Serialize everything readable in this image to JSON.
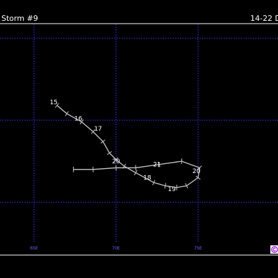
{
  "header": {
    "title": "Storm #9",
    "dates": "14-22 D"
  },
  "map": {
    "grid_color": "#3a3aff",
    "frame_color": "#ffffff",
    "track_color": "#c8c8c8",
    "longitude_ticks": [
      {
        "value": 65,
        "label": "65E"
      },
      {
        "value": 70,
        "label": "70E"
      },
      {
        "value": 75,
        "label": "75E"
      }
    ],
    "latitude_gridlines": 3,
    "track_points": [
      {
        "lon": 66.4,
        "lat": 15.9
      },
      {
        "lon": 67.0,
        "lat": 15.4
      },
      {
        "lon": 67.9,
        "lat": 14.9
      },
      {
        "lon": 68.6,
        "lat": 14.3
      },
      {
        "lon": 69.2,
        "lat": 13.7
      },
      {
        "lon": 69.6,
        "lat": 13.0
      },
      {
        "lon": 70.0,
        "lat": 12.6
      },
      {
        "lon": 70.5,
        "lat": 12.2
      },
      {
        "lon": 71.2,
        "lat": 11.8
      },
      {
        "lon": 72.3,
        "lat": 11.2
      },
      {
        "lon": 73.0,
        "lat": 11.0
      },
      {
        "lon": 73.7,
        "lat": 10.9
      },
      {
        "lon": 74.3,
        "lat": 11.0
      },
      {
        "lon": 75.0,
        "lat": 11.5
      },
      {
        "lon": 75.1,
        "lat": 12.1
      },
      {
        "lon": 74.0,
        "lat": 12.5
      },
      {
        "lon": 72.6,
        "lat": 12.3
      },
      {
        "lon": 71.2,
        "lat": 12.1
      },
      {
        "lon": 70.0,
        "lat": 12.1
      },
      {
        "lon": 68.6,
        "lat": 12.0
      },
      {
        "lon": 67.4,
        "lat": 12.0
      }
    ],
    "day_labels": [
      {
        "text": "15",
        "lon": 66.2,
        "lat": 16.1
      },
      {
        "text": "16",
        "lon": 67.7,
        "lat": 15.1
      },
      {
        "text": "17",
        "lon": 68.9,
        "lat": 14.5
      },
      {
        "text": "20",
        "lon": 70.0,
        "lat": 12.5
      },
      {
        "text": "18",
        "lon": 71.9,
        "lat": 11.5
      },
      {
        "text": "19",
        "lon": 73.4,
        "lat": 10.8
      },
      {
        "text": "20",
        "lon": 74.9,
        "lat": 11.9
      },
      {
        "text": "21",
        "lon": 72.5,
        "lat": 12.3
      }
    ],
    "copyright_icon": "copyright-icon"
  }
}
